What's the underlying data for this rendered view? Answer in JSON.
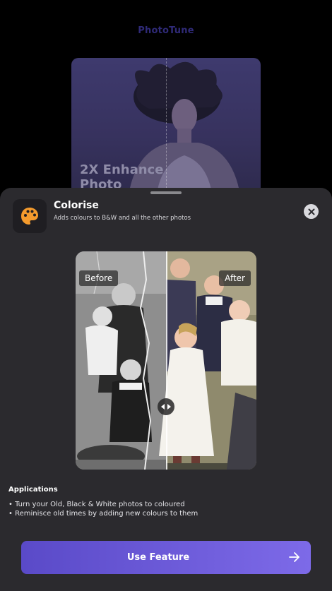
{
  "app": {
    "title": "PhotoTune"
  },
  "background_card": {
    "label": "2X Enhance Photo"
  },
  "sheet": {
    "feature": {
      "icon": "palette-icon",
      "title": "Colorise",
      "subtitle": "Adds colours to B&W and all the other photos"
    },
    "close_icon": "close-icon",
    "compare": {
      "before_label": "Before",
      "after_label": "After",
      "handle_icon": "split-handle-icon"
    },
    "applications": {
      "heading": "Applications",
      "items": [
        "• Turn your Old, Black & White photos to coloured",
        "• Reminisce old times by adding new colours to them"
      ]
    },
    "cta": {
      "label": "Use Feature",
      "icon": "arrow-right-icon"
    }
  },
  "colors": {
    "sheet_bg": "#2b2a2e",
    "accent_start": "#5a4ac8",
    "accent_end": "#7d6ae8",
    "palette_icon": "#f59b2d"
  }
}
